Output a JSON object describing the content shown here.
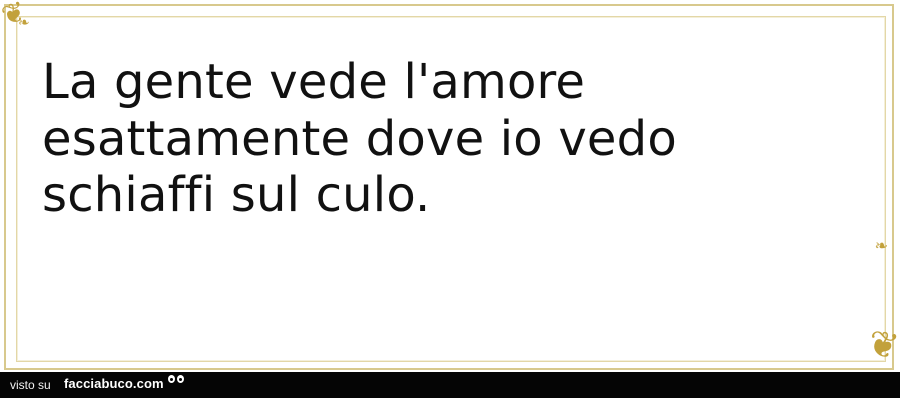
{
  "quote": {
    "text": "La gente vede l'amore esattamente dove io vedo schiaffi sul culo."
  },
  "footer": {
    "prefix": "visto su",
    "site": "facciabuco.com"
  },
  "icons": {
    "frame_ornament": "rose-icon",
    "brand_mark": "eyes-icon"
  },
  "colors": {
    "background": "#ffffff",
    "frame_gold": "#c2a13b",
    "text": "#111111",
    "bottom_bar": "#050505"
  }
}
